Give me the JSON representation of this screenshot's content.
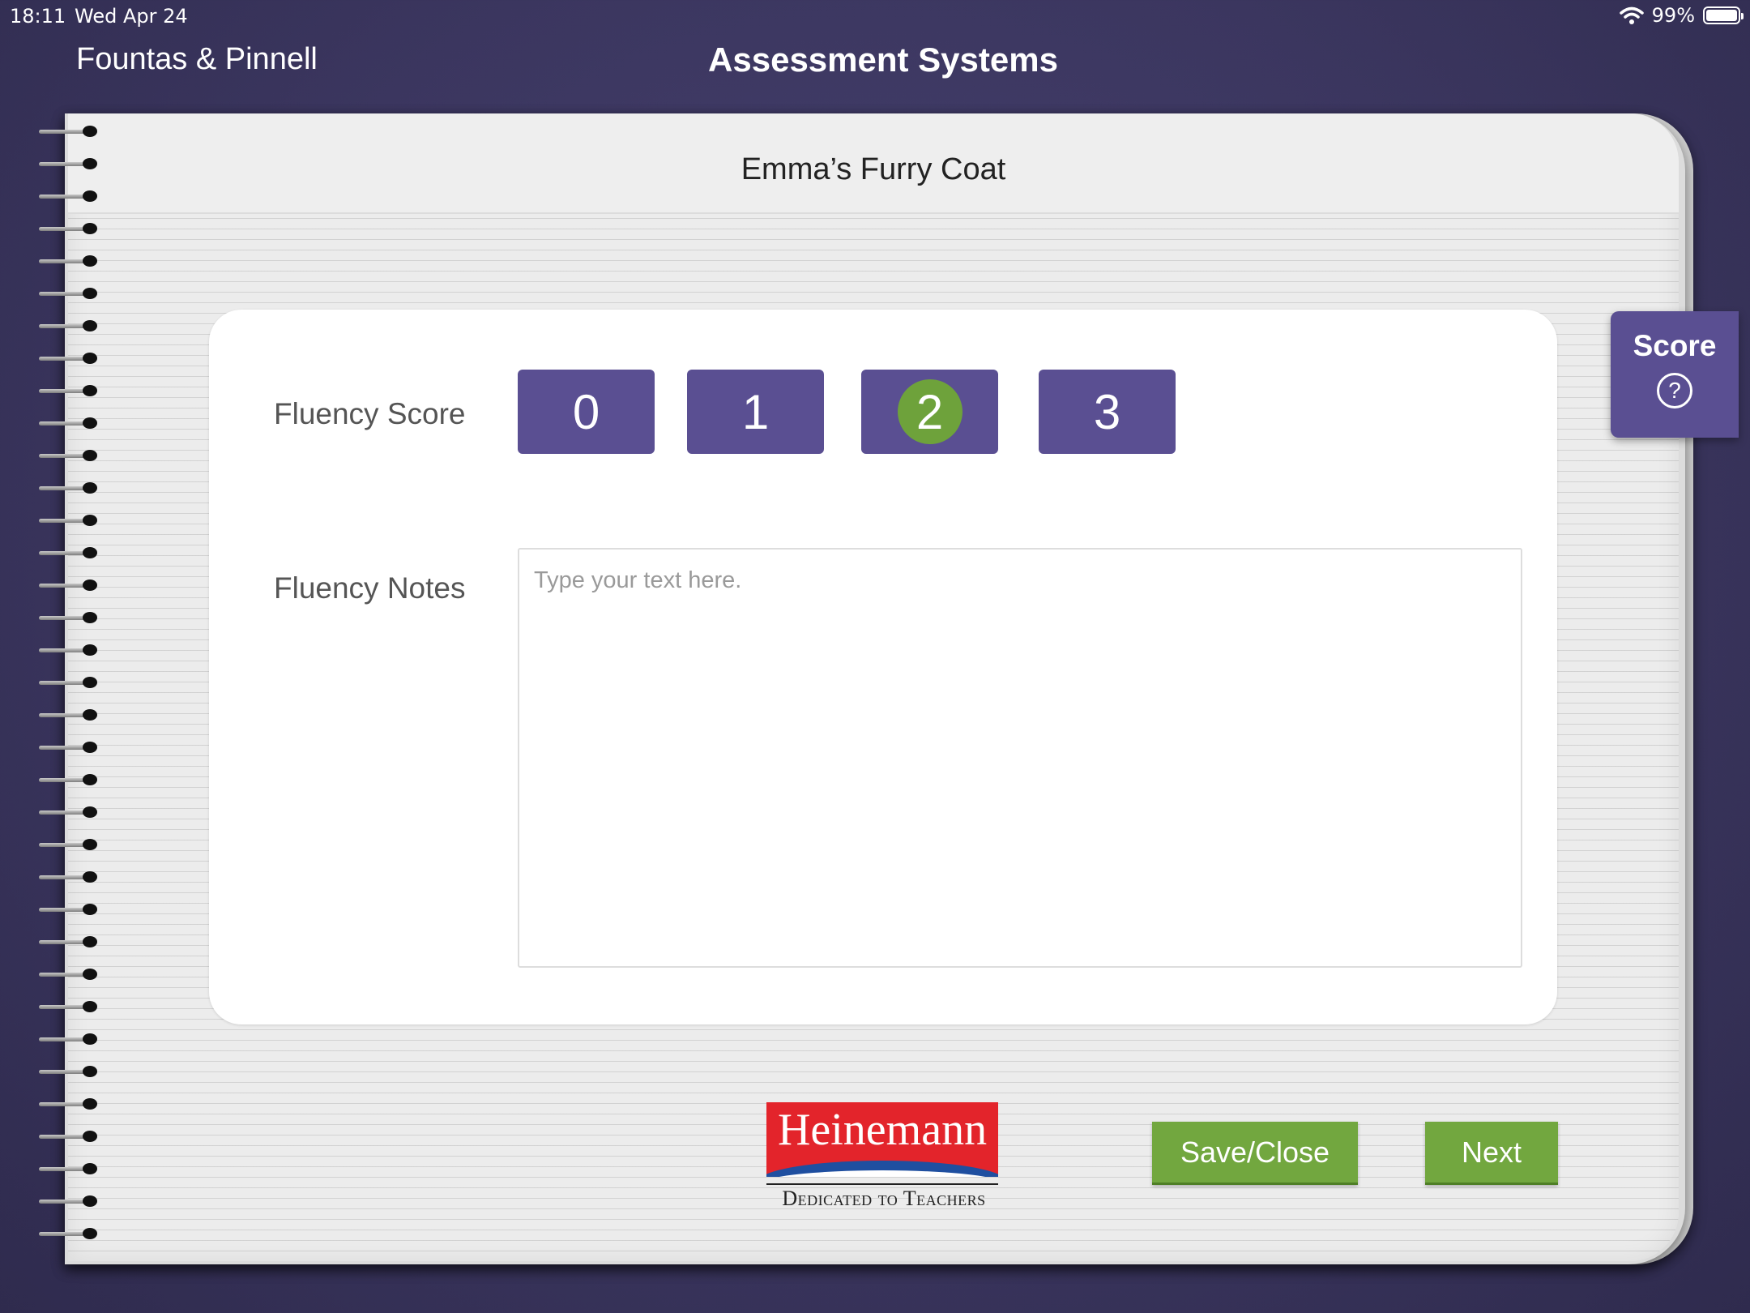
{
  "status_bar": {
    "time": "18:11",
    "date": "Wed Apr 24",
    "battery": "99%"
  },
  "nav": {
    "back_label": "Fountas & Pinnell",
    "title": "Assessment Systems"
  },
  "book": {
    "title": "Emma’s Furry Coat"
  },
  "fluency": {
    "score_label": "Fluency Score",
    "score_options": [
      "0",
      "1",
      "2",
      "3"
    ],
    "selected_score": "2",
    "notes_label": "Fluency Notes",
    "notes_value": "",
    "notes_placeholder": "Type your text here."
  },
  "score_tab": {
    "label": "Score",
    "icon": "question-mark-icon"
  },
  "logo": {
    "name": "Heinemann",
    "tagline": "Dedicated to Teachers"
  },
  "actions": {
    "save_close": "Save/Close",
    "next": "Next"
  },
  "colors": {
    "primary_purple": "#5a4f92",
    "action_green": "#72a73f",
    "selected_green": "#6ea23b",
    "background": "#3b365f"
  }
}
